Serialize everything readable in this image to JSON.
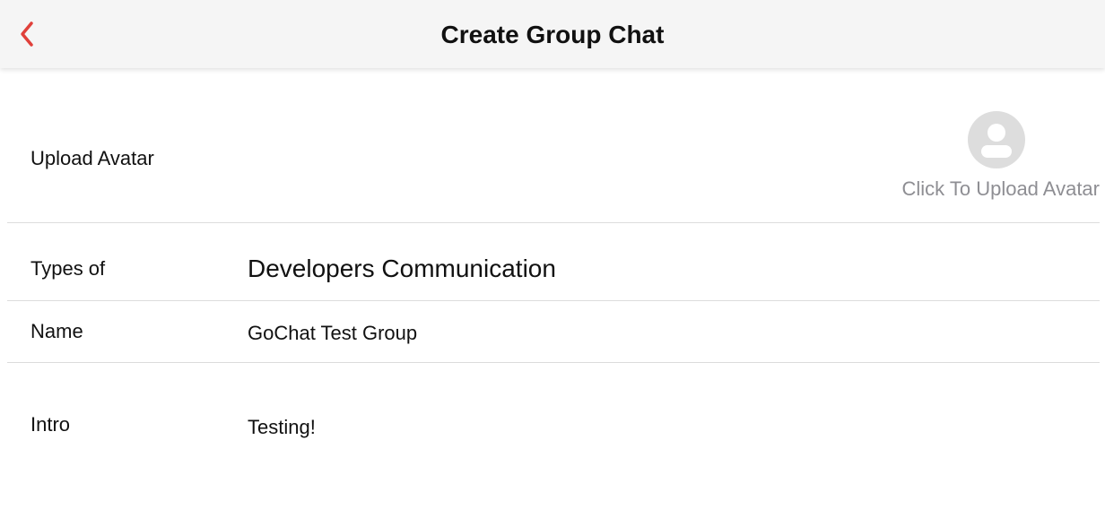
{
  "header": {
    "title": "Create Group Chat",
    "back_icon": "chevron-left-icon",
    "accent_color": "#e0403a"
  },
  "form": {
    "avatar": {
      "label": "Upload Avatar",
      "hint": "Click To Upload Avatar",
      "icon": "user-avatar-placeholder-icon"
    },
    "type": {
      "label": "Types of",
      "value": "Developers Communication"
    },
    "name": {
      "label": "Name",
      "value": "GoChat Test Group"
    },
    "intro": {
      "label": "Intro",
      "value": "Testing!"
    }
  }
}
